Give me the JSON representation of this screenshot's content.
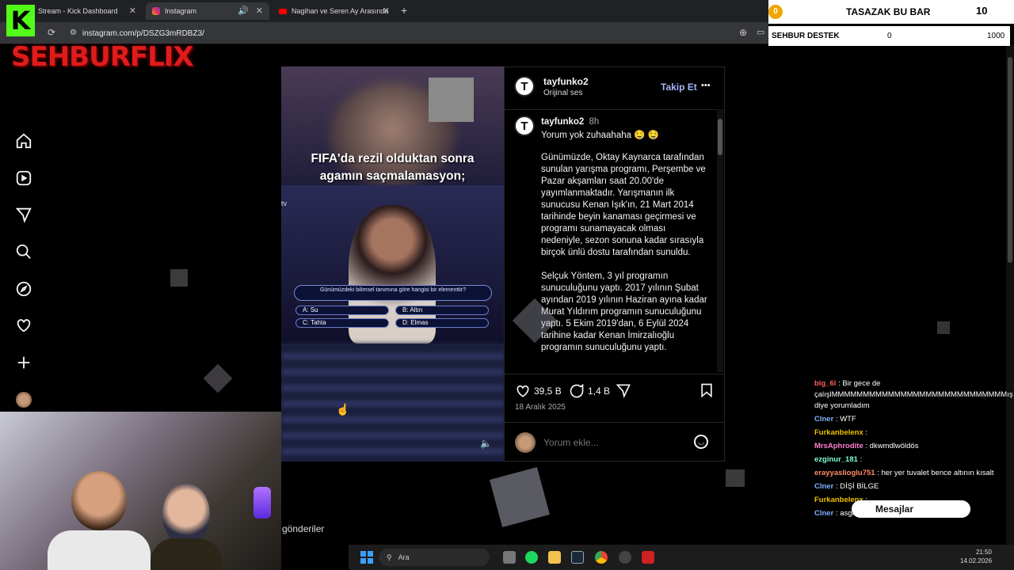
{
  "browser": {
    "tabs": [
      {
        "label": "Stream - Kick Dashboard"
      },
      {
        "label": "Instagram"
      },
      {
        "label": "Nagihan ve Seren Ay Arasında"
      }
    ],
    "url": "instagram.com/p/DSZG3mRDBZ3/"
  },
  "overlay": {
    "brand": "SEHBURFLIX",
    "kick_letter": "K",
    "top_counter_left": "0",
    "top_title": "TASAZAK BU BAR",
    "top_counter_right": "10",
    "destek_label": "SEHBUR DESTEK",
    "destek_current": "0",
    "destek_goal": "1000",
    "messages_label": "Mesajlar"
  },
  "post": {
    "username": "tayfunko2",
    "audio": "Orijinal ses",
    "follow": "Takip Et",
    "more": "•••",
    "comment_user": "tayfunko2",
    "comment_time": "8h",
    "comment_text": "Yorum yok zuhaahaha 🤤 🤤",
    "caption_paragraphs": [
      "Günümüzde, Oktay Kaynarca tarafından sunulan yarışma programı, Perşembe ve Pazar akşamları saat 20.00'de yayımlanmaktadır. Yarışmanın ilk sunucusu Kenan Işık'ın, 21 Mart 2014 tarihinde beyin kanaması geçirmesi ve programı sunamayacak olması nedeniyle, sezon sonuna kadar sırasıyla birçok ünlü dostu tarafından sunuldu.",
      "Selçuk Yöntem, 3 yıl programın sunuculuğunu yaptı. 2017 yılının Şubat ayından 2019 yılının Haziran ayına kadar Murat Yıldırım programın sunuculuğunu yaptı. 5 Ekim 2019'dan, 6 Eylül 2024 tarihine kadar Kenan İmirzalıoğlu programın sunuculuğunu yaptı."
    ],
    "likes": "39,5 B",
    "comments": "1,4 B",
    "date": "18 Aralık 2025",
    "comment_placeholder": "Yorum ekle...",
    "media": {
      "overlay_text": "FIFA'da rezil olduktan sonra agamın saçmalamasyon;",
      "question": "Günümüzdeki bilimsel tanımına göre hangisi bir elementtir?",
      "answers": [
        "A: Su",
        "B: Altın",
        "C: Tahta",
        "D: Elmas"
      ],
      "tv_label": "tv"
    }
  },
  "page_footer_text": "gönderiler",
  "chat": [
    {
      "user": "big_6l",
      "text": ": Bir gece de çalışlMMMMMMMMMMMMMMMMMMMMMMMMMMMMış diye yorumladım",
      "color": "#ff5b5b"
    },
    {
      "user": "Clner",
      "text": ": WTF",
      "color": "#7fb3ff"
    },
    {
      "user": "Furkanbelenx",
      "text": ":",
      "color": "#f0c000"
    },
    {
      "user": "MrsAphrodite",
      "text": ": dkwmdlwöldös",
      "color": "#ff7fd5"
    },
    {
      "user": "ezginur_181",
      "text": ":",
      "color": "#7fffd4"
    },
    {
      "user": "erayyaslioglu751",
      "text": ": her yer tuvalet bence altının kısalt",
      "color": "#ff8c69"
    },
    {
      "user": "Clner",
      "text": ": DİŞİ BİLGE",
      "color": "#7fb3ff"
    },
    {
      "user": "Furkanbelenx",
      "text": ":",
      "color": "#f0c000"
    },
    {
      "user": "Clner",
      "text": ": asgkasgjaslgkasgasgasg",
      "color": "#7fb3ff"
    }
  ],
  "taskbar": {
    "search": "Ara",
    "time": "21:50",
    "date": "14.02.2026"
  },
  "colors": {
    "instagram_blue": "#0095f6",
    "follow_text": "#a5b4fc",
    "brand_red": "#e01b1b",
    "kick_green": "#53fc18"
  }
}
